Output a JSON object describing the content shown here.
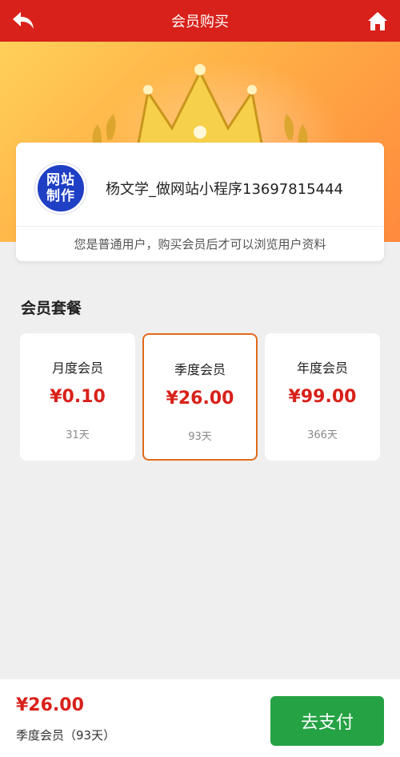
{
  "header": {
    "title": "会员购买",
    "back_icon": "back-arrow-icon",
    "home_icon": "home-icon"
  },
  "profile": {
    "avatar_line1": "网站",
    "avatar_line2": "制作",
    "username": "杨文学_做网站小程序13697815444",
    "notice": "您是普通用户，购买会员后才可以浏览用户资料"
  },
  "plans": {
    "section_title": "会员套餐",
    "items": [
      {
        "name": "月度会员",
        "price": "¥0.10",
        "days": "31天",
        "selected": false
      },
      {
        "name": "季度会员",
        "price": "¥26.00",
        "days": "93天",
        "selected": true
      },
      {
        "name": "年度会员",
        "price": "¥99.00",
        "days": "366天",
        "selected": false
      }
    ]
  },
  "footer": {
    "total_price": "¥26.00",
    "selected_desc": "季度会员（93天）",
    "pay_label": "去支付"
  },
  "colors": {
    "header_red": "#d8211a",
    "price_red": "#d8211a",
    "selected_border": "#e06a1c",
    "pay_green": "#25a244"
  }
}
